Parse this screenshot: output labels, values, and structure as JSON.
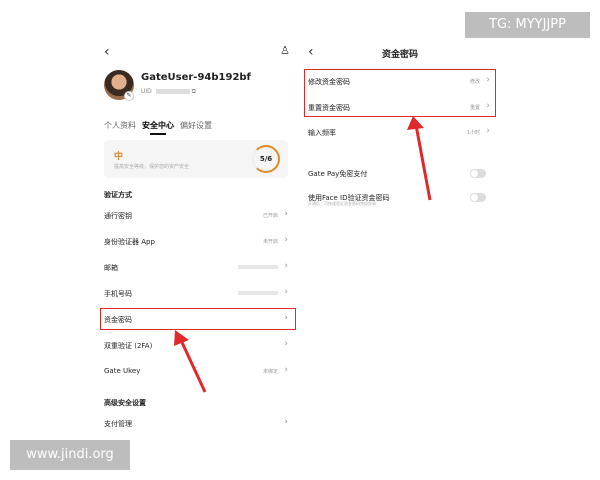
{
  "watermarks": {
    "top_right": "TG: MYYJJPP",
    "bottom_left": "www.jindi.org"
  },
  "left": {
    "user": {
      "name": "GateUser-94b192bf",
      "uid_prefix": "UID"
    },
    "tabs": [
      "个人资料",
      "安全中心",
      "偏好设置"
    ],
    "active_tab": "安全中心",
    "security_level": {
      "level": "中",
      "desc": "提高安全等级，保护您的资产安全",
      "score": "5/6"
    },
    "verify_section": "验证方式",
    "items": [
      {
        "label": "通行密钥",
        "value": "已开启"
      },
      {
        "label": "身份验证器 App",
        "value": "未开启"
      },
      {
        "label": "邮箱",
        "value": ""
      },
      {
        "label": "手机号码",
        "value": ""
      },
      {
        "label": "资金密码",
        "value": ""
      },
      {
        "label": "双重验证 (2FA)",
        "value": ""
      },
      {
        "label": "Gate Ukey",
        "value": "未绑定"
      }
    ],
    "advanced_section": "高级安全设置",
    "advanced_items": [
      {
        "label": "支付管理",
        "value": ""
      }
    ]
  },
  "right": {
    "title": "资金密码",
    "items": [
      {
        "label": "修改资金密码",
        "value": "修改"
      },
      {
        "label": "重置资金密码",
        "value": "重置"
      },
      {
        "label": "输入频率",
        "value": "1小时"
      }
    ],
    "toggles": [
      {
        "label": "Gate Pay免密支付",
        "sub": ""
      },
      {
        "label": "使用Face ID验证资金密码",
        "sub": "开通后，可快速验证资金密码完成交易"
      }
    ]
  },
  "colors": {
    "highlight": "#e02a2a",
    "accent": "#e08a2c"
  }
}
